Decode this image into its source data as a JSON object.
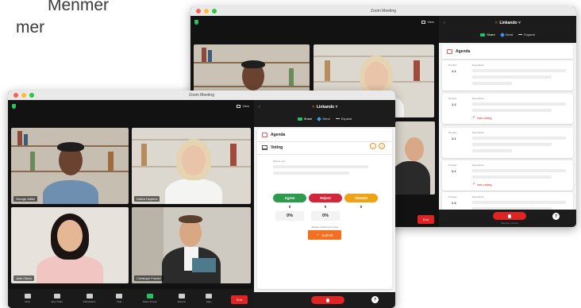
{
  "background_text": {
    "line1": "Menmer",
    "line2": "mer"
  },
  "back_window": {
    "title": "Zoom Meeting",
    "view_label": "View",
    "brand": "Linkando",
    "actions": {
      "share": "Share",
      "send": "Send",
      "expand": "Expand"
    },
    "end_label": "End",
    "agenda_title": "Agenda",
    "items": [
      {
        "number_label": "Number",
        "desc_label": "Description",
        "number": "1.1",
        "has_voting": false
      },
      {
        "number_label": "Number",
        "desc_label": "Description",
        "number": "1.2",
        "has_voting": true
      },
      {
        "number_label": "Number",
        "desc_label": "Description",
        "number": "2.1",
        "has_voting": false
      },
      {
        "number_label": "Number",
        "desc_label": "Description",
        "number": "2.2",
        "has_voting": true
      },
      {
        "number_label": "Number",
        "desc_label": "Description",
        "number": "2.3",
        "has_voting": false
      }
    ],
    "has_voting_label": "has voting",
    "status_text": "Meeting running"
  },
  "front_window": {
    "title": "Zoom Meeting",
    "view_label": "View",
    "participants": [
      {
        "name": "George Miller"
      },
      {
        "name": "Debra Hopkins"
      },
      {
        "name": "Julie Olson"
      },
      {
        "name": "Christoph Franke"
      }
    ],
    "toolbar": [
      {
        "label": "Mute",
        "green": false
      },
      {
        "label": "Stop Video",
        "green": false
      },
      {
        "label": "Participants",
        "green": false
      },
      {
        "label": "Chat",
        "green": false
      },
      {
        "label": "Share Screen",
        "green": true
      },
      {
        "label": "Record",
        "green": false
      },
      {
        "label": "Apps",
        "green": false
      }
    ],
    "end_label": "End",
    "brand": "Linkando",
    "actions": {
      "share": "Share",
      "send": "Send",
      "expand": "Expand"
    },
    "agenda_title": "Agenda",
    "voting_title": "Voting",
    "please_vote": "Please vote",
    "votes": [
      {
        "label": "Agree",
        "count": "0",
        "pct": "0%"
      },
      {
        "label": "Reject",
        "count": "0",
        "pct": "0%"
      },
      {
        "label": "Abstain",
        "count": "0"
      }
    ],
    "confirm_label": "Please confirm your vote",
    "submit_label": "Submit"
  },
  "colors": {
    "brand_orange": "#ff5a1f",
    "agree": "#2e9a4e",
    "reject": "#d3263a",
    "abstain": "#f0a216",
    "end_red": "#e02424"
  }
}
